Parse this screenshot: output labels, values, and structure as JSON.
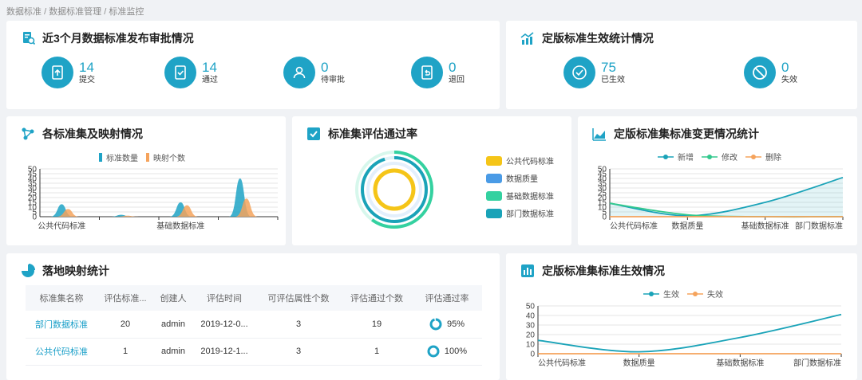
{
  "breadcrumb": [
    "数据标准",
    "数据标准管理",
    "标准监控"
  ],
  "approval": {
    "title": "近3个月数据标准发布审批情况",
    "stats": [
      {
        "num": "14",
        "label": "提交",
        "icon": "upload-doc-icon"
      },
      {
        "num": "14",
        "label": "通过",
        "icon": "check-doc-icon"
      },
      {
        "num": "0",
        "label": "待审批",
        "icon": "user-icon"
      },
      {
        "num": "0",
        "label": "退回",
        "icon": "return-doc-icon"
      }
    ]
  },
  "effective": {
    "title": "定版标准生效统计情况",
    "stats": [
      {
        "num": "75",
        "label": "已生效",
        "icon": "check-circle-icon"
      },
      {
        "num": "0",
        "label": "失效",
        "icon": "ban-icon"
      }
    ]
  },
  "mapping": {
    "title": "各标准集及映射情况",
    "legend": [
      "标准数量",
      "映射个数"
    ]
  },
  "passrate": {
    "title": "标准集评估通过率",
    "legend": [
      "公共代码标准",
      "数据质量",
      "基础数据标准",
      "部门数据标准"
    ]
  },
  "change": {
    "title": "定版标准集标准变更情况统计",
    "legend": [
      "新增",
      "修改",
      "删除"
    ]
  },
  "landing": {
    "title": "落地映射统计",
    "columns": [
      "标准集名称",
      "评估标准...",
      "创建人",
      "评估时间",
      "可评估属性个数",
      "评估通过个数",
      "评估通过率"
    ],
    "rows": [
      [
        "部门数据标准",
        "20",
        "admin",
        "2019-12-0...",
        "3",
        "19",
        "95%"
      ],
      [
        "公共代码标准",
        "1",
        "admin",
        "2019-12-1...",
        "3",
        "1",
        "100%"
      ]
    ]
  },
  "effect2": {
    "title": "定版标准集标准生效情况",
    "legend": [
      "生效",
      "失效"
    ]
  },
  "colors": {
    "primary": "#1fa3c6",
    "orange": "#f5a35c",
    "green": "#34d1a0",
    "yellow": "#f5c518",
    "blue": "#4a9be6",
    "teal": "#1aa3b8"
  },
  "chart_data": [
    {
      "type": "area",
      "title": "各标准集及映射情况",
      "categories": [
        "公共代码标准",
        "",
        "基础数据标准",
        ""
      ],
      "ylim": [
        0,
        50
      ],
      "yticks": [
        0,
        5,
        10,
        15,
        20,
        25,
        30,
        35,
        40,
        45,
        50
      ],
      "series": [
        {
          "name": "标准数量",
          "values": [
            13,
            2,
            15,
            40
          ]
        },
        {
          "name": "映射个数",
          "values": [
            8,
            1,
            12,
            19
          ]
        }
      ]
    },
    {
      "type": "pie",
      "title": "标准集评估通过率",
      "series": [
        {
          "name": "公共代码标准",
          "values": [
            100
          ]
        },
        {
          "name": "数据质量",
          "values": [
            0
          ]
        },
        {
          "name": "基础数据标准",
          "values": [
            60
          ]
        },
        {
          "name": "部门数据标准",
          "values": [
            95
          ]
        }
      ]
    },
    {
      "type": "line",
      "title": "定版标准集标准变更情况统计",
      "categories": [
        "公共代码标准",
        "数据质量",
        "基础数据标准",
        "部门数据标准"
      ],
      "ylim": [
        0,
        50
      ],
      "yticks": [
        0,
        5,
        10,
        15,
        20,
        25,
        30,
        35,
        40,
        45,
        50
      ],
      "series": [
        {
          "name": "新增",
          "values": [
            14,
            1,
            15,
            41
          ]
        },
        {
          "name": "修改",
          "values": [
            14,
            2,
            0,
            0
          ]
        },
        {
          "name": "删除",
          "values": [
            0,
            0,
            0,
            0
          ]
        }
      ]
    },
    {
      "type": "line",
      "title": "定版标准集标准生效情况",
      "categories": [
        "公共代码标准",
        "数据质量",
        "基础数据标准",
        "部门数据标准"
      ],
      "ylim": [
        0,
        50
      ],
      "yticks": [
        0,
        10,
        20,
        30,
        40,
        50
      ],
      "series": [
        {
          "name": "生效",
          "values": [
            14,
            2,
            17,
            41
          ]
        },
        {
          "name": "失效",
          "values": [
            0,
            0,
            0,
            0
          ]
        }
      ]
    }
  ]
}
